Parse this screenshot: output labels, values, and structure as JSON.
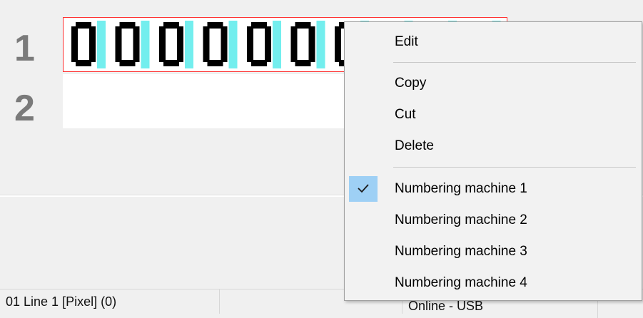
{
  "editor": {
    "line_numbers": [
      "1",
      "2"
    ],
    "line1_content": "0000000000",
    "line1_colors": {
      "digit": "#000000",
      "gap": "#00e0e0",
      "border": "#ff3333"
    }
  },
  "context_menu": {
    "items": [
      {
        "label": "Edit",
        "checked": false
      },
      {
        "label": "Copy",
        "checked": false
      },
      {
        "label": "Cut",
        "checked": false
      },
      {
        "label": "Delete",
        "checked": false
      },
      {
        "label": "Numbering machine 1",
        "checked": true
      },
      {
        "label": "Numbering machine 2",
        "checked": false
      },
      {
        "label": "Numbering machine 3",
        "checked": false
      },
      {
        "label": "Numbering machine 4",
        "checked": false
      }
    ],
    "check_highlight": "#9ed0f5"
  },
  "statusbar": {
    "field1": "01 Line 1 [Pixel] (0)",
    "field2": "",
    "field3": "Online - USB",
    "field4": ""
  }
}
